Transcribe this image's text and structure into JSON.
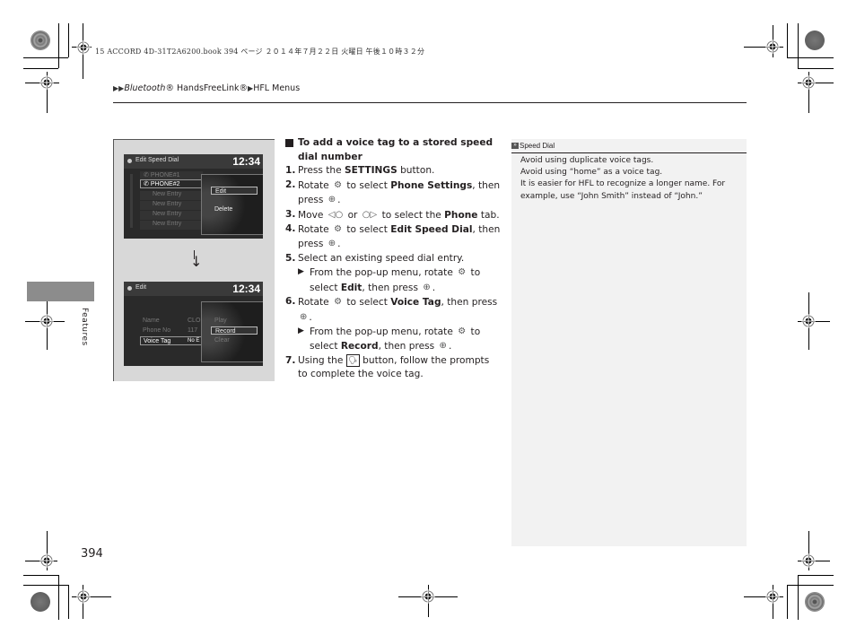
{
  "print_header": {
    "meta_text": "15 ACCORD 4D-31T2A6200.book  394 ページ  ２０１４年７月２２日  火曜日  午後１０時３２分"
  },
  "breadcrumb": {
    "items": [
      {
        "label": "Bluetooth",
        "italic": true,
        "suffix": "® HandsFreeLink®"
      },
      {
        "label": "HFL Menus"
      }
    ],
    "part1": "Bluetooth",
    "part1_suffix": "® HandsFreeLink®",
    "part2": "HFL Menus"
  },
  "side_tab": {
    "label": "Features",
    "color": "#8c8c8c"
  },
  "figure": {
    "screen1": {
      "title": "Edit Speed Dial",
      "clock": "12:34",
      "list": [
        "PHONE#1",
        "PHONE#2",
        "New Entry",
        "New Entry",
        "New Entry",
        "New Entry"
      ],
      "selected_entry": "PHONE#2",
      "popup": [
        "Edit",
        "Delete"
      ],
      "popup_selected": "Edit"
    },
    "arrow": "↓",
    "screen2": {
      "title": "Edit",
      "clock": "12:34",
      "fields": [
        {
          "label": "Name",
          "value": "CLO"
        },
        {
          "label": "Phone No",
          "value": "117"
        },
        {
          "label": "Voice Tag",
          "value": "No E"
        }
      ],
      "selected_field": "Voice Tag",
      "popup": [
        "Play",
        "Record",
        "Clear"
      ],
      "popup_selected": "Record"
    }
  },
  "instructions": {
    "heading": "To add a voice tag to a stored speed dial number",
    "steps": [
      {
        "num": "1.",
        "pre": "Press the ",
        "bold": "SETTINGS",
        "post": " button."
      },
      {
        "num": "2.",
        "pre": "Rotate ",
        "icon": "selector-knob-rotate-icon",
        "mid": " to select ",
        "bold": "Phone Settings",
        "post": ", then press ",
        "icon2": "selector-knob-press-icon",
        "end": "."
      },
      {
        "num": "3.",
        "pre": "Move ",
        "icon": "knob-left-icon",
        "mid": " or ",
        "icon2": "knob-right-icon",
        "post": " to select the ",
        "bold": "Phone",
        "end": " tab."
      },
      {
        "num": "4.",
        "pre": "Rotate ",
        "icon": "selector-knob-rotate-icon",
        "mid": " to select ",
        "bold": "Edit Speed Dial",
        "post": ", then press ",
        "icon2": "selector-knob-press-icon",
        "end": "."
      },
      {
        "num": "5.",
        "pre": "Select an existing speed dial entry."
      },
      {
        "num": "6.",
        "pre": "Rotate ",
        "icon": "selector-knob-rotate-icon",
        "mid": " to select ",
        "bold": "Voice Tag",
        "post": ", then press ",
        "icon2": "selector-knob-press-icon",
        "end": "."
      },
      {
        "num": "7.",
        "pre": "Using the ",
        "icon": "talk-button-icon",
        "post": " button, follow the prompts to complete the voice tag."
      }
    ],
    "sub5": {
      "pre": "From the pop-up menu, rotate ",
      "mid": " to select ",
      "bold": "Edit",
      "post": ", then press ",
      "end": "."
    },
    "sub6": {
      "pre": "From the pop-up menu, rotate ",
      "mid": " to select ",
      "bold": "Record",
      "post": ", then press ",
      "end": "."
    },
    "labels": {
      "s1": "1.",
      "s2": "2.",
      "s3": "3.",
      "s4": "4.",
      "s5": "5.",
      "s6": "6.",
      "s7": "7.",
      "press_the": "Press the ",
      "settings": "SETTINGS",
      "button_dot": " button.",
      "rotate": "Rotate ",
      "to_select": " to select ",
      "phone_settings": "Phone Settings",
      "then_press": ", then press ",
      "dot": ".",
      "move": "Move ",
      "or": " or ",
      "to_select_the": " to select the ",
      "phone": "Phone",
      "tab_dot": " tab.",
      "edit_speed_dial": "Edit Speed Dial",
      "select_existing": "Select an existing speed dial entry.",
      "from_popup": "From the pop-up menu, rotate ",
      "select": " to select ",
      "edit": "Edit",
      "record": "Record",
      "voice_tag": "Voice Tag",
      "using_the": "Using the ",
      "follow": " button, follow the prompts to complete the voice tag."
    }
  },
  "notes": {
    "title": "Speed Dial",
    "lines": [
      "Avoid using duplicate voice tags.",
      "Avoid using “home” as a voice tag.",
      "It is easier for HFL to recognize a longer name. For example, use “John Smith” instead of “John.”"
    ]
  },
  "page_number": "394"
}
